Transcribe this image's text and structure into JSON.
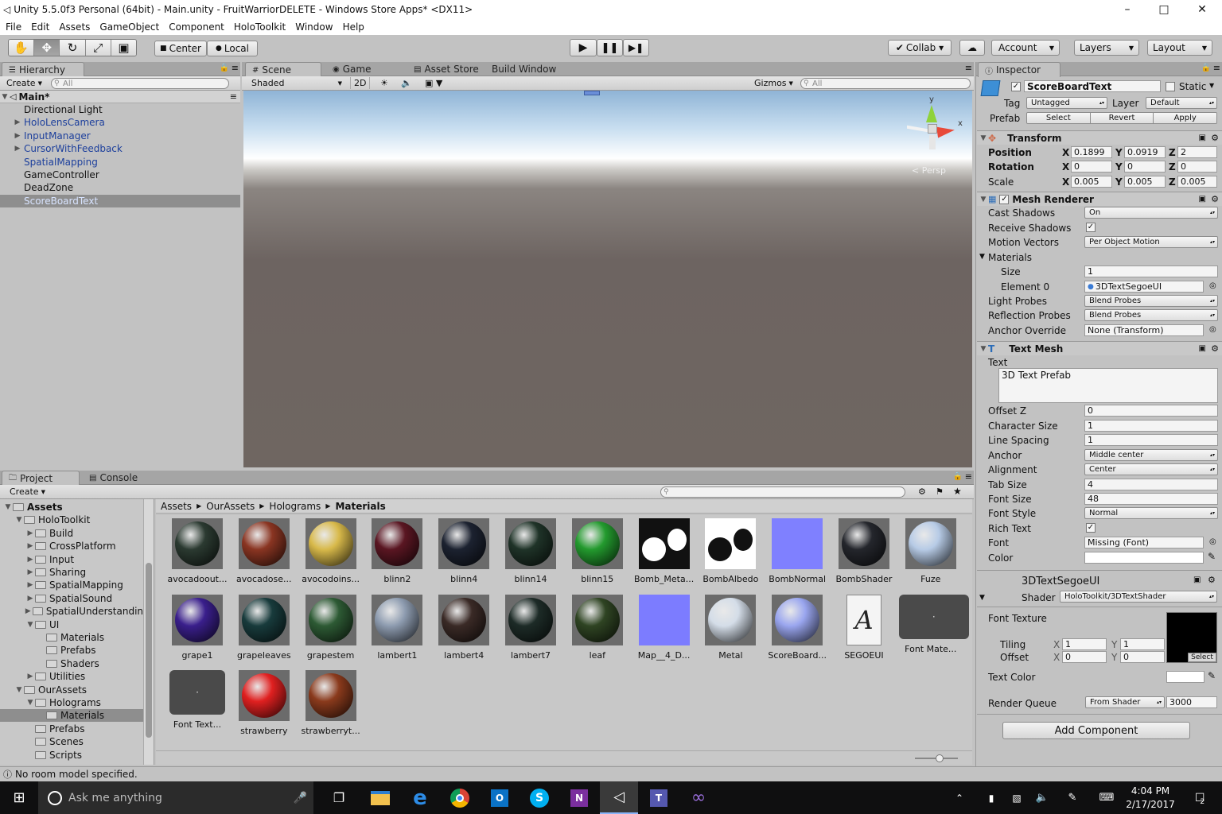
{
  "window": {
    "title": "Unity 5.5.0f3 Personal (64bit) - Main.unity - FruitWarriorDELETE - Windows Store Apps* <DX11>",
    "controls": [
      "–",
      "□",
      "✕"
    ]
  },
  "menu": [
    "File",
    "Edit",
    "Assets",
    "GameObject",
    "Component",
    "HoloToolkit",
    "Window",
    "Help"
  ],
  "toolbar": {
    "pivot": "Center",
    "space": "Local",
    "collab": "Collab ▾",
    "account": "Account",
    "layers": "Layers",
    "layout": "Layout"
  },
  "hierarchy": {
    "tab": "Hierarchy",
    "create": "Create",
    "search": "All",
    "scene": "Main*",
    "items": [
      {
        "label": "Directional Light",
        "prefab": false,
        "expandable": false
      },
      {
        "label": "HoloLensCamera",
        "prefab": true,
        "expandable": true
      },
      {
        "label": "InputManager",
        "prefab": true,
        "expandable": true
      },
      {
        "label": "CursorWithFeedback",
        "prefab": true,
        "expandable": true
      },
      {
        "label": "SpatialMapping",
        "prefab": true,
        "expandable": false
      },
      {
        "label": "GameController",
        "prefab": false,
        "expandable": false
      },
      {
        "label": "DeadZone",
        "prefab": false,
        "expandable": false
      },
      {
        "label": "ScoreBoardText",
        "prefab": true,
        "expandable": false,
        "selected": true
      }
    ]
  },
  "scene": {
    "tabs": [
      "Scene",
      "Game",
      "Asset Store",
      "Build Window"
    ],
    "shading": "Shaded",
    "mode2d": "2D",
    "gizmos": "Gizmos",
    "search": "All",
    "persp": "Persp",
    "gizmo_axes": {
      "y": "y",
      "x": "x"
    }
  },
  "project": {
    "tabs": [
      "Project",
      "Console"
    ],
    "create": "Create",
    "breadcrumb": [
      "Assets",
      "OurAssets",
      "Holograms",
      "Materials"
    ],
    "tree": [
      {
        "label": "Assets",
        "depth": 0,
        "bold": true,
        "arrow": "▼"
      },
      {
        "label": "HoloToolkit",
        "depth": 1,
        "arrow": "▼"
      },
      {
        "label": "Build",
        "depth": 2,
        "arrow": "▶"
      },
      {
        "label": "CrossPlatform",
        "depth": 2,
        "arrow": "▶"
      },
      {
        "label": "Input",
        "depth": 2,
        "arrow": "▶"
      },
      {
        "label": "Sharing",
        "depth": 2,
        "arrow": "▶"
      },
      {
        "label": "SpatialMapping",
        "depth": 2,
        "arrow": "▶"
      },
      {
        "label": "SpatialSound",
        "depth": 2,
        "arrow": "▶"
      },
      {
        "label": "SpatialUnderstandin",
        "depth": 2,
        "arrow": "▶"
      },
      {
        "label": "UI",
        "depth": 2,
        "arrow": "▼"
      },
      {
        "label": "Materials",
        "depth": 3,
        "arrow": ""
      },
      {
        "label": "Prefabs",
        "depth": 3,
        "arrow": ""
      },
      {
        "label": "Shaders",
        "depth": 3,
        "arrow": ""
      },
      {
        "label": "Utilities",
        "depth": 2,
        "arrow": "▶"
      },
      {
        "label": "OurAssets",
        "depth": 1,
        "arrow": "▼"
      },
      {
        "label": "Holograms",
        "depth": 2,
        "arrow": "▼"
      },
      {
        "label": "Materials",
        "depth": 3,
        "arrow": "",
        "selected": true
      },
      {
        "label": "Prefabs",
        "depth": 2,
        "arrow": ""
      },
      {
        "label": "Scenes",
        "depth": 2,
        "arrow": ""
      },
      {
        "label": "Scripts",
        "depth": 2,
        "arrow": ""
      }
    ],
    "assets": [
      {
        "label": "avocadoout...",
        "kind": "ball",
        "color": "#2b3a31"
      },
      {
        "label": "avocadose...",
        "kind": "ball",
        "color": "#8a3522"
      },
      {
        "label": "avocodoins...",
        "kind": "ball",
        "color": "#d8b94a"
      },
      {
        "label": "blinn2",
        "kind": "ball",
        "color": "#5a1622"
      },
      {
        "label": "blinn4",
        "kind": "ball",
        "color": "#1c2230"
      },
      {
        "label": "blinn14",
        "kind": "ball",
        "color": "#1f3328"
      },
      {
        "label": "blinn15",
        "kind": "ball",
        "color": "#239a2e"
      },
      {
        "label": "Bomb_Meta...",
        "kind": "bomb",
        "color": "#ffffff"
      },
      {
        "label": "BombAlbedo",
        "kind": "bomb",
        "color": "#111111"
      },
      {
        "label": "BombNormal",
        "kind": "flat",
        "color": "#7f80ff"
      },
      {
        "label": "BombShader",
        "kind": "ball",
        "color": "#24262c"
      },
      {
        "label": "Fuze",
        "kind": "ball",
        "color": "#b7cbe6"
      },
      {
        "label": "grape1",
        "kind": "ball",
        "color": "#3a1f8c"
      },
      {
        "label": "grapeleaves",
        "kind": "ball",
        "color": "#183b3c"
      },
      {
        "label": "grapestem",
        "kind": "ball",
        "color": "#2d5a34"
      },
      {
        "label": "lambert1",
        "kind": "ball",
        "color": "#8e9cb0"
      },
      {
        "label": "lambert4",
        "kind": "ball",
        "color": "#3a2a26"
      },
      {
        "label": "lambert7",
        "kind": "ball",
        "color": "#1d2b27"
      },
      {
        "label": "leaf",
        "kind": "ball",
        "color": "#2f4423"
      },
      {
        "label": "Map__4_D...",
        "kind": "flat",
        "color": "#7c7cff"
      },
      {
        "label": "Metal",
        "kind": "ball",
        "color": "#d4dde8"
      },
      {
        "label": "ScoreBoard...",
        "kind": "ball",
        "color": "#9aa6ef"
      },
      {
        "label": "SEGOEUI",
        "kind": "font",
        "color": "#ffffff"
      },
      {
        "label": "Font Mate...",
        "kind": "fontmat",
        "color": "#4a4a4a"
      },
      {
        "label": "Font Text...",
        "kind": "fonttex",
        "color": "#4a4a4a"
      },
      {
        "label": "strawberry",
        "kind": "ball",
        "color": "#e02020"
      },
      {
        "label": "strawberryt...",
        "kind": "ball",
        "color": "#8a3a1c"
      }
    ]
  },
  "inspector": {
    "tab": "Inspector",
    "object_name": "ScoreBoardText",
    "static_label": "Static",
    "tag_label": "Tag",
    "tag": "Untagged",
    "layer_label": "Layer",
    "layer": "Default",
    "prefab_label": "Prefab",
    "prefab_buttons": [
      "Select",
      "Revert",
      "Apply"
    ],
    "transform": {
      "title": "Transform",
      "rows": [
        {
          "label": "Position",
          "x": "0.1899",
          "y": "0.0919",
          "z": "2"
        },
        {
          "label": "Rotation",
          "x": "0",
          "y": "0",
          "z": "0"
        },
        {
          "label": "Scale",
          "x": "0.005",
          "y": "0.005",
          "z": "0.005"
        }
      ]
    },
    "mesh_renderer": {
      "title": "Mesh Renderer",
      "cast_shadows_label": "Cast Shadows",
      "cast_shadows": "On",
      "receive_shadows_label": "Receive Shadows",
      "motion_vectors_label": "Motion Vectors",
      "motion_vectors": "Per Object Motion",
      "materials_label": "Materials",
      "size_label": "Size",
      "size": "1",
      "element0_label": "Element 0",
      "element0": "3DTextSegoeUI",
      "light_probes_label": "Light Probes",
      "light_probes": "Blend Probes",
      "reflection_probes_label": "Reflection Probes",
      "reflection_probes": "Blend Probes",
      "anchor_override_label": "Anchor Override",
      "anchor_override": "None (Transform)"
    },
    "text_mesh": {
      "title": "Text Mesh",
      "text_label": "Text",
      "text": "3D Text Prefab",
      "offset_z_label": "Offset Z",
      "offset_z": "0",
      "char_size_label": "Character Size",
      "char_size": "1",
      "line_spacing_label": "Line Spacing",
      "line_spacing": "1",
      "anchor_label": "Anchor",
      "anchor": "Middle center",
      "alignment_label": "Alignment",
      "alignment": "Center",
      "tab_size_label": "Tab Size",
      "tab_size": "4",
      "font_size_label": "Font Size",
      "font_size": "48",
      "font_style_label": "Font Style",
      "font_style": "Normal",
      "rich_text_label": "Rich Text",
      "font_label": "Font",
      "font": "Missing (Font)",
      "color_label": "Color"
    },
    "material": {
      "name": "3DTextSegoeUI",
      "shader_label": "Shader",
      "shader": "HoloToolkit/3DTextShader",
      "font_texture_label": "Font Texture",
      "tiling_label": "Tiling",
      "tiling_x": "1",
      "tiling_y": "1",
      "offset_label": "Offset",
      "offset_x": "0",
      "offset_y": "0",
      "select_label": "Select",
      "text_color_label": "Text Color",
      "render_queue_label": "Render Queue",
      "render_queue_mode": "From Shader",
      "render_queue": "3000"
    },
    "add_component": "Add Component"
  },
  "status": "No room model specified.",
  "taskbar": {
    "search": "Ask me anything",
    "time": "4:04 PM",
    "date": "2/17/2017",
    "notifications": "2"
  }
}
